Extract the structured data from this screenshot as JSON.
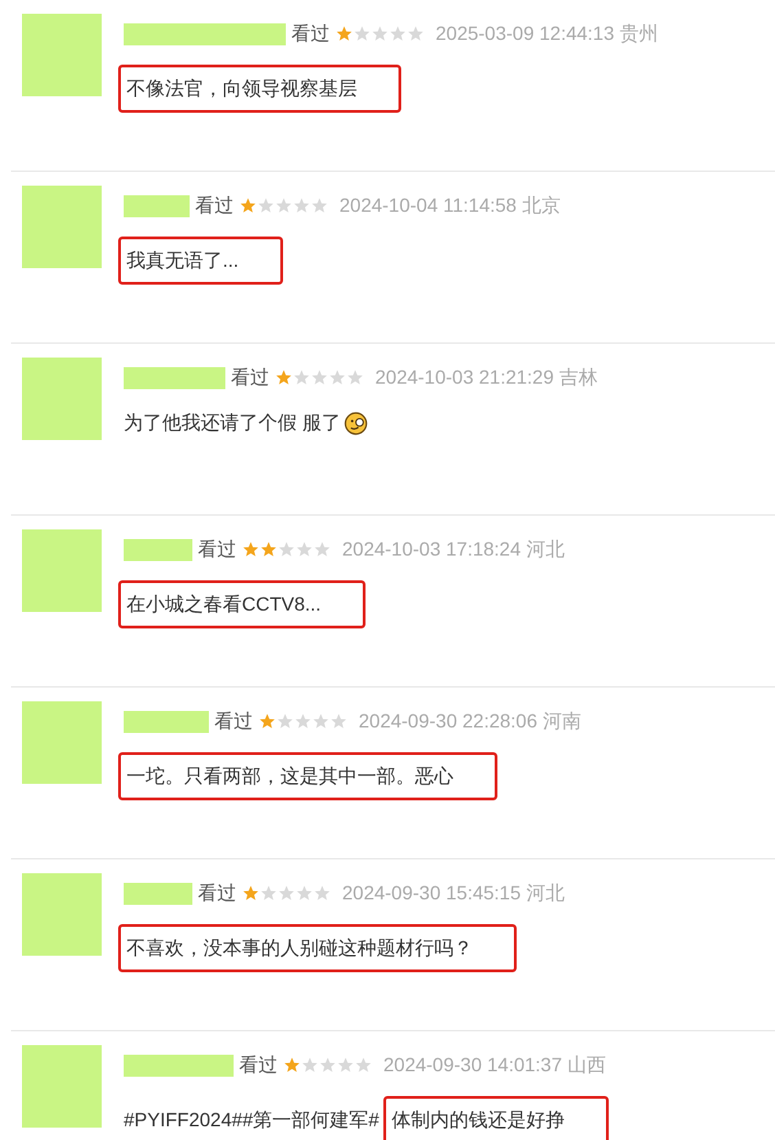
{
  "comments": [
    {
      "status": "看过",
      "stars": 1,
      "time": "2025-03-09 12:44:13",
      "location": "贵州",
      "segments": [
        {
          "text": "不像法官，向领导视察基层",
          "highlighted": true
        }
      ],
      "emoji": false
    },
    {
      "status": "看过",
      "stars": 1,
      "time": "2024-10-04 11:14:58",
      "location": "北京",
      "segments": [
        {
          "text": "我真无语了...",
          "highlighted": true
        }
      ],
      "emoji": false
    },
    {
      "status": "看过",
      "stars": 1,
      "time": "2024-10-03 21:21:29",
      "location": "吉林",
      "segments": [
        {
          "text": "为了他我还请了个假 服了",
          "highlighted": false
        }
      ],
      "emoji": true
    },
    {
      "status": "看过",
      "stars": 2,
      "time": "2024-10-03 17:18:24",
      "location": "河北",
      "segments": [
        {
          "text": "在小城之春看CCTV8...",
          "highlighted": true
        }
      ],
      "emoji": false
    },
    {
      "status": "看过",
      "stars": 1,
      "time": "2024-09-30 22:28:06",
      "location": "河南",
      "segments": [
        {
          "text": "一坨。只看两部，这是其中一部。恶心",
          "highlighted": true
        }
      ],
      "emoji": false
    },
    {
      "status": "看过",
      "stars": 1,
      "time": "2024-09-30 15:45:15",
      "location": "河北",
      "segments": [
        {
          "text": "不喜欢，没本事的人别碰这种题材行吗？",
          "highlighted": true
        }
      ],
      "emoji": false
    },
    {
      "status": "看过",
      "stars": 1,
      "time": "2024-09-30 14:01:37",
      "location": "山西",
      "segments": [
        {
          "text": "#PYIFF2024##第一部何建军#",
          "highlighted": false
        },
        {
          "text": "体制内的钱还是好挣",
          "highlighted": true
        }
      ],
      "emoji": false
    }
  ]
}
